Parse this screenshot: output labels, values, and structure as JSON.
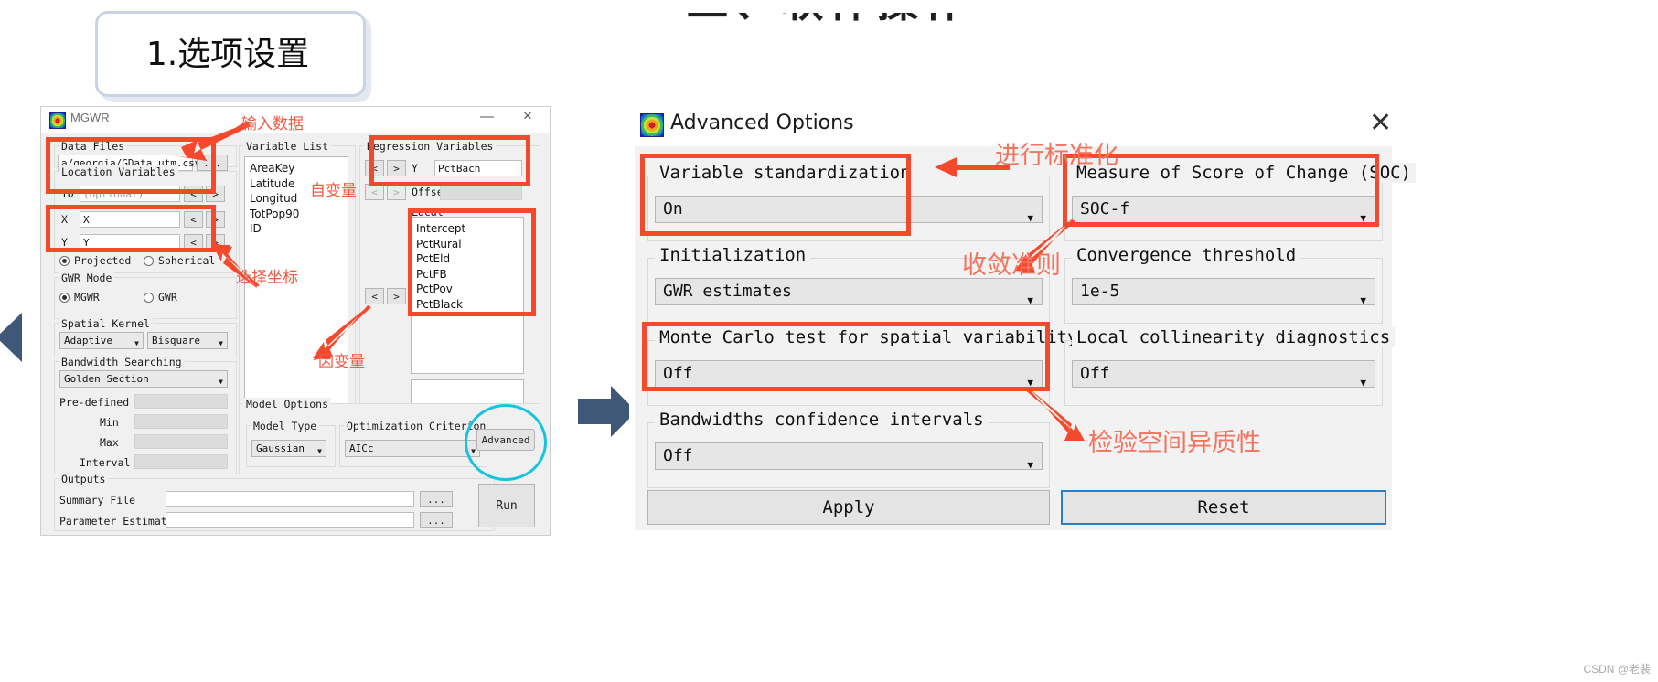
{
  "slide": {
    "title": "二、软件操作",
    "step_badge": "1.选项设置",
    "watermark": "CSDN @老裴"
  },
  "mgwr_window": {
    "title": "MGWR",
    "logo_icon": "mgwr-logo-icon",
    "minimize_icon": "minimize-icon",
    "close_icon": "close-icon",
    "data_files": {
      "caption": "Data Files",
      "path_value": "a/georgia/GData_utm.csv",
      "browse_label": "..."
    },
    "location_variables": {
      "caption": "Location Variables",
      "rows": [
        {
          "label": "ID",
          "value": "",
          "placeholder": "(optional)",
          "prev": "<",
          "next": ">"
        },
        {
          "label": "X",
          "value": "X",
          "placeholder": "",
          "prev": "<",
          "next": ">"
        },
        {
          "label": "Y",
          "value": "Y",
          "placeholder": "",
          "prev": "<",
          "next": ">"
        }
      ],
      "projection": [
        {
          "label": "Projected",
          "selected": true
        },
        {
          "label": "Spherical",
          "selected": false
        }
      ]
    },
    "gwr_mode": {
      "caption": "GWR Mode",
      "options": [
        {
          "label": "MGWR",
          "selected": true
        },
        {
          "label": "GWR",
          "selected": false
        }
      ]
    },
    "spatial_kernel": {
      "caption": "Spatial Kernel",
      "type_value": "Adaptive",
      "function_value": "Bisquare"
    },
    "bandwidth_searching": {
      "caption": "Bandwidth Searching",
      "method_value": "Golden Section",
      "fields": [
        {
          "label": "Pre-defined",
          "value": ""
        },
        {
          "label": "Min",
          "value": ""
        },
        {
          "label": "Max",
          "value": ""
        },
        {
          "label": "Interval",
          "value": ""
        }
      ]
    },
    "outputs": {
      "caption": "Outputs",
      "rows": [
        {
          "label": "Summary File",
          "value": "",
          "browse": "..."
        },
        {
          "label": "Parameter Estimates",
          "value": "",
          "browse": "..."
        }
      ]
    },
    "variable_list": {
      "caption": "Variable List",
      "items": [
        "AreaKey",
        "Latitude",
        "Longitud",
        "TotPop90",
        "ID"
      ]
    },
    "regression_variables": {
      "caption": "Regression Variables",
      "y_label": "Y",
      "y_value": "PctBach",
      "offset_label": "Offset",
      "offset_value": "",
      "local_label": "Local",
      "local_items": [
        "Intercept",
        "PctRural",
        "PctEld",
        "PctFB",
        "PctPov",
        "PctBlack"
      ],
      "prev": "<",
      "next": ">"
    },
    "model_options": {
      "caption": "Model Options",
      "model_type": {
        "caption": "Model Type",
        "value": "Gaussian"
      },
      "optimization_criterion": {
        "caption": "Optimization Criterion",
        "value": "AICc"
      },
      "advanced_label": "Advanced"
    },
    "run_label": "Run"
  },
  "advanced_options": {
    "title": "Advanced Options",
    "logo_icon": "mgwr-logo-icon",
    "close_icon": "close-icon",
    "groups": [
      {
        "caption": "Variable standardization",
        "value": "On"
      },
      {
        "caption": "Measure of Score of Change (SOC)",
        "value": "SOC-f"
      },
      {
        "caption": "Initialization",
        "value": "GWR estimates"
      },
      {
        "caption": "Convergence threshold",
        "value": "1e-5"
      },
      {
        "caption": "Monte Carlo test for spatial variability",
        "value": "Off"
      },
      {
        "caption": "Local collinearity diagnostics",
        "value": "Off"
      },
      {
        "caption": "Bandwidths confidence intervals",
        "value": "Off"
      }
    ],
    "apply_label": "Apply",
    "reset_label": "Reset"
  },
  "annotations": {
    "input_data": "输入数据",
    "independent_var": "自变量",
    "select_coords": "选择坐标",
    "dependent_var": "因变量",
    "standardize": "进行标准化",
    "convergence_criterion": "收敛准则",
    "spatial_heterogeneity": "检验空间异质性"
  },
  "colors": {
    "annotation_red": "#f4492d",
    "annotation_text_red": "#f4735e",
    "highlight_teal": "#17c4e0",
    "focus_blue": "#2d7fc1",
    "slide_arrow": "#3f5878"
  }
}
